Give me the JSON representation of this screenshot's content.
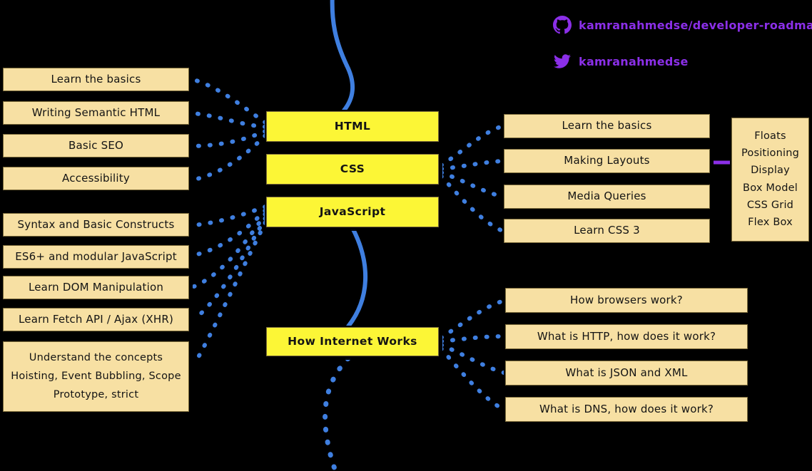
{
  "social": {
    "github": {
      "icon": "github-icon",
      "handle": "kamranahmedse/developer-roadmap"
    },
    "twitter": {
      "icon": "twitter-icon",
      "handle": "kamranahmedse"
    }
  },
  "colors": {
    "background": "#000000",
    "node_fill": "#f7e0a3",
    "spine_fill": "#fcf636",
    "connector": "#3f7fe0",
    "spine_line": "#3f7fe0",
    "purple": "#8b2fe8",
    "text": "#141414"
  },
  "spine_nodes": [
    {
      "id": "html",
      "label": "HTML"
    },
    {
      "id": "css",
      "label": "CSS"
    },
    {
      "id": "javascript",
      "label": "JavaScript"
    },
    {
      "id": "internet",
      "label": "How Internet Works"
    }
  ],
  "html_topics": [
    {
      "label": "Learn the basics"
    },
    {
      "label": "Writing Semantic HTML"
    },
    {
      "label": "Basic SEO"
    },
    {
      "label": "Accessibility"
    }
  ],
  "javascript_topics": [
    {
      "label": "Syntax and Basic Constructs"
    },
    {
      "label": "ES6+ and modular JavaScript"
    },
    {
      "label": "Learn DOM Manipulation"
    },
    {
      "label": "Learn Fetch API / Ajax (XHR)"
    }
  ],
  "javascript_concepts": {
    "lines": [
      "Understand the concepts",
      "Hoisting, Event Bubbling, Scope",
      "Prototype, strict"
    ]
  },
  "css_topics": [
    {
      "label": "Learn the basics"
    },
    {
      "label": "Making Layouts"
    },
    {
      "label": "Media Queries"
    },
    {
      "label": "Learn CSS 3"
    }
  ],
  "css_layout_topics": {
    "items": [
      "Floats",
      "Positioning",
      "Display",
      "Box Model",
      "CSS Grid",
      "Flex Box"
    ]
  },
  "internet_topics": [
    {
      "label": "How browsers work?"
    },
    {
      "label": "What is HTTP, how does it work?"
    },
    {
      "label": "What is JSON and XML"
    },
    {
      "label": "What is DNS, how does it work?"
    }
  ]
}
